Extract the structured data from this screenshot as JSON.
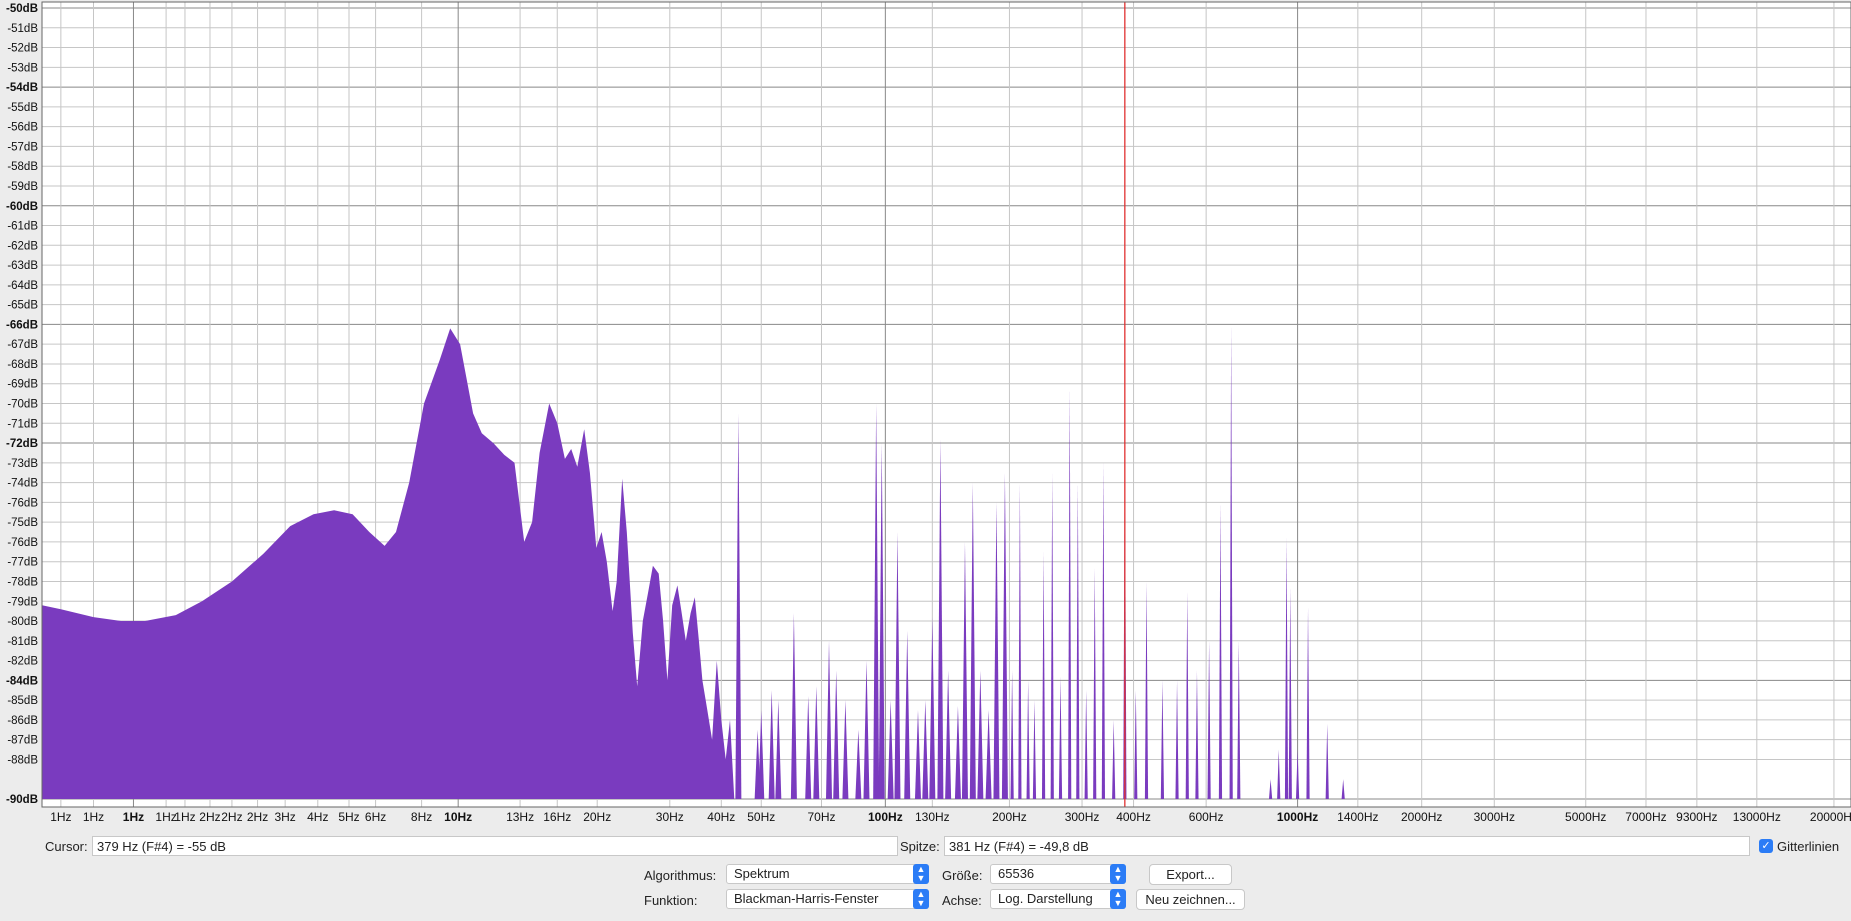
{
  "colors": {
    "plot_background": "#ffffff",
    "grid_major": "#888888",
    "grid_minor": "#c6c6c6",
    "spectrum_fill": "#7a3bbf",
    "cursor_line": "#e03030",
    "accent": "#2b7cf6",
    "panel_background": "#ececec"
  },
  "chart_data": {
    "type": "area",
    "xlabel": "",
    "ylabel": "",
    "x_scale": "log",
    "xlim_hz": [
      0.9,
      22000
    ],
    "ylim_db": [
      -90,
      -50
    ],
    "grid": true,
    "y_ticks": [
      {
        "label": "-50dB",
        "value": -50,
        "bold": true
      },
      {
        "label": "-51dB",
        "value": -51
      },
      {
        "label": "-52dB",
        "value": -52
      },
      {
        "label": "-53dB",
        "value": -53
      },
      {
        "label": "-54dB",
        "value": -54,
        "bold": true
      },
      {
        "label": "-55dB",
        "value": -55
      },
      {
        "label": "-56dB",
        "value": -56
      },
      {
        "label": "-57dB",
        "value": -57
      },
      {
        "label": "-58dB",
        "value": -58
      },
      {
        "label": "-59dB",
        "value": -59
      },
      {
        "label": "-60dB",
        "value": -60,
        "bold": true
      },
      {
        "label": "-61dB",
        "value": -61
      },
      {
        "label": "-62dB",
        "value": -62
      },
      {
        "label": "-63dB",
        "value": -63
      },
      {
        "label": "-64dB",
        "value": -64
      },
      {
        "label": "-65dB",
        "value": -65
      },
      {
        "label": "-66dB",
        "value": -66,
        "bold": true
      },
      {
        "label": "-67dB",
        "value": -67
      },
      {
        "label": "-68dB",
        "value": -68
      },
      {
        "label": "-69dB",
        "value": -69
      },
      {
        "label": "-70dB",
        "value": -70
      },
      {
        "label": "-71dB",
        "value": -71
      },
      {
        "label": "-72dB",
        "value": -72,
        "bold": true
      },
      {
        "label": "-73dB",
        "value": -73
      },
      {
        "label": "-74dB",
        "value": -74
      },
      {
        "label": "-76dB",
        "value": -75
      },
      {
        "label": "-75dB",
        "value": -76
      },
      {
        "label": "-76dB",
        "value": -77
      },
      {
        "label": "-77dB",
        "value": -78
      },
      {
        "label": "-78dB",
        "value": -79
      },
      {
        "label": "-79dB",
        "value": -80
      },
      {
        "label": "-80dB",
        "value": -81
      },
      {
        "label": "-81dB",
        "value": -82
      },
      {
        "label": "-82dB",
        "value": -83
      },
      {
        "label": "-84dB",
        "value": -84,
        "bold": true
      },
      {
        "label": "-85dB",
        "value": -85
      },
      {
        "label": "-86dB",
        "value": -86
      },
      {
        "label": "-87dB",
        "value": -87
      },
      {
        "label": "-88dB",
        "value": -88
      },
      {
        "label": "-90dB",
        "value": -90,
        "bold": true
      }
    ],
    "x_ticks": [
      {
        "label": "1Hz",
        "hz": 1.0
      },
      {
        "label": "1Hz",
        "hz": 1.2
      },
      {
        "label": "1Hz",
        "hz": 1.5,
        "bold": true
      },
      {
        "label": "1Hz",
        "hz": 1.8
      },
      {
        "label": "1Hz",
        "hz": 2.0
      },
      {
        "label": "2Hz",
        "hz": 2.3
      },
      {
        "label": "2Hz",
        "hz": 2.6
      },
      {
        "label": "2Hz",
        "hz": 3.0
      },
      {
        "label": "3Hz",
        "hz": 3.5
      },
      {
        "label": "4Hz",
        "hz": 4.2
      },
      {
        "label": "5Hz",
        "hz": 5.0
      },
      {
        "label": "6Hz",
        "hz": 5.8
      },
      {
        "label": "8Hz",
        "hz": 7.5
      },
      {
        "label": "10Hz",
        "hz": 9.2,
        "bold": true
      },
      {
        "label": "13Hz",
        "hz": 13
      },
      {
        "label": "16Hz",
        "hz": 16
      },
      {
        "label": "20Hz",
        "hz": 20
      },
      {
        "label": "30Hz",
        "hz": 30
      },
      {
        "label": "40Hz",
        "hz": 40
      },
      {
        "label": "50Hz",
        "hz": 50
      },
      {
        "label": "70Hz",
        "hz": 70
      },
      {
        "label": "100Hz",
        "hz": 100,
        "bold": true
      },
      {
        "label": "130Hz",
        "hz": 130
      },
      {
        "label": "200Hz",
        "hz": 200
      },
      {
        "label": "300Hz",
        "hz": 300
      },
      {
        "label": "400Hz",
        "hz": 400
      },
      {
        "label": "600Hz",
        "hz": 600
      },
      {
        "label": "1000Hz",
        "hz": 1000,
        "bold": true
      },
      {
        "label": "1400Hz",
        "hz": 1400
      },
      {
        "label": "2000Hz",
        "hz": 2000
      },
      {
        "label": "3000Hz",
        "hz": 3000
      },
      {
        "label": "5000Hz",
        "hz": 5000
      },
      {
        "label": "7000Hz",
        "hz": 7000
      },
      {
        "label": "9300Hz",
        "hz": 9300
      },
      {
        "label": "13000Hz",
        "hz": 13000
      },
      {
        "label": "20000Hz",
        "hz": 20000
      }
    ],
    "series": [
      {
        "continuous_envelope": [
          [
            0.9,
            -80.2
          ],
          [
            1.0,
            -80.4
          ],
          [
            1.2,
            -80.8
          ],
          [
            1.4,
            -81.0
          ],
          [
            1.6,
            -81.0
          ],
          [
            1.9,
            -80.7
          ],
          [
            2.2,
            -80.0
          ],
          [
            2.6,
            -79.0
          ],
          [
            3.1,
            -77.6
          ],
          [
            3.6,
            -76.2
          ],
          [
            4.1,
            -75.6
          ],
          [
            4.6,
            -75.4
          ],
          [
            5.1,
            -75.6
          ],
          [
            5.6,
            -76.5
          ],
          [
            6.1,
            -77.2
          ],
          [
            6.5,
            -76.5
          ],
          [
            7.0,
            -74.0
          ],
          [
            7.6,
            -70.0
          ],
          [
            8.3,
            -67.8
          ],
          [
            8.8,
            -66.2
          ],
          [
            9.3,
            -67.0
          ],
          [
            10.0,
            -70.5
          ],
          [
            10.5,
            -71.5
          ],
          [
            11.2,
            -72.0
          ],
          [
            11.9,
            -72.6
          ],
          [
            12.6,
            -73.0
          ],
          [
            13.3,
            -77.0
          ],
          [
            13.9,
            -76.0
          ],
          [
            14.5,
            -72.5
          ],
          [
            15.3,
            -70.0
          ],
          [
            16.0,
            -71.0
          ],
          [
            16.7,
            -72.8
          ],
          [
            17.3,
            -72.3
          ],
          [
            17.9,
            -73.2
          ],
          [
            18.6,
            -71.3
          ],
          [
            19.2,
            -73.5
          ],
          [
            19.9,
            -77.3
          ],
          [
            20.5,
            -76.5
          ],
          [
            21.1,
            -78.0
          ],
          [
            21.8,
            -80.5
          ],
          [
            22.3,
            -79.0
          ],
          [
            23.0,
            -73.8
          ],
          [
            23.6,
            -76.5
          ],
          [
            24.4,
            -81.6
          ],
          [
            25.0,
            -84.3
          ],
          [
            25.8,
            -81.0
          ],
          [
            26.6,
            -79.5
          ],
          [
            27.3,
            -78.2
          ],
          [
            28.2,
            -78.6
          ],
          [
            28.9,
            -81.0
          ],
          [
            29.6,
            -84.0
          ],
          [
            30.4,
            -80.2
          ],
          [
            31.3,
            -79.2
          ],
          [
            32.0,
            -80.5
          ],
          [
            32.8,
            -82.0
          ],
          [
            33.7,
            -80.6
          ],
          [
            34.5,
            -79.8
          ],
          [
            35.3,
            -82.0
          ],
          [
            36.0,
            -84.0
          ],
          [
            37.0,
            -85.5
          ],
          [
            38.0,
            -87.0
          ],
          [
            39.0,
            -83.0
          ],
          [
            40.0,
            -86.0
          ],
          [
            41.0,
            -88.0
          ],
          [
            42.0,
            -86.0
          ],
          [
            43.0,
            -90.0
          ]
        ],
        "peaks_hz_db": [
          [
            44,
            -70.5
          ],
          [
            49,
            -86.5
          ],
          [
            50,
            -85.5
          ],
          [
            53,
            -84.5
          ],
          [
            55,
            -85.0
          ],
          [
            60,
            -80.6
          ],
          [
            65,
            -84.8
          ],
          [
            68,
            -84.3
          ],
          [
            73,
            -82.0
          ],
          [
            76,
            -83.5
          ],
          [
            80,
            -85.0
          ],
          [
            86,
            -86.5
          ],
          [
            90,
            -83.0
          ],
          [
            95,
            -70.0
          ],
          [
            98,
            -72.0
          ],
          [
            103,
            -85.0
          ],
          [
            107,
            -76.5
          ],
          [
            113,
            -81.5
          ],
          [
            120,
            -85.5
          ],
          [
            125,
            -85.0
          ],
          [
            130,
            -80.8
          ],
          [
            136,
            -71.8
          ],
          [
            142,
            -83.5
          ],
          [
            150,
            -85.3
          ],
          [
            156,
            -77.0
          ],
          [
            163,
            -74.0
          ],
          [
            170,
            -83.5
          ],
          [
            178,
            -85.5
          ],
          [
            186,
            -75.0
          ],
          [
            195,
            -73.5
          ],
          [
            203,
            -83.5
          ],
          [
            212,
            -74.0
          ],
          [
            222,
            -84.0
          ],
          [
            230,
            -85.0
          ],
          [
            242,
            -77.5
          ],
          [
            254,
            -73.5
          ],
          [
            266,
            -83.8
          ],
          [
            280,
            -69.2
          ],
          [
            293,
            -74.0
          ],
          [
            307,
            -84.5
          ],
          [
            322,
            -78.3
          ],
          [
            338,
            -73.0
          ],
          [
            358,
            -86.0
          ],
          [
            381,
            -71.5
          ],
          [
            405,
            -84.5
          ],
          [
            430,
            -79.0
          ],
          [
            470,
            -84.0
          ],
          [
            510,
            -84.0
          ],
          [
            540,
            -79.5
          ],
          [
            570,
            -83.5
          ],
          [
            610,
            -82.0
          ],
          [
            650,
            -75.0
          ],
          [
            690,
            -66.0
          ],
          [
            720,
            -82.0
          ],
          [
            860,
            -89.0
          ],
          [
            900,
            -87.5
          ],
          [
            940,
            -76.8
          ],
          [
            960,
            -79.3
          ],
          [
            1000,
            -87.5
          ],
          [
            1060,
            -80.3
          ],
          [
            1180,
            -86.2
          ],
          [
            1290,
            -89.0
          ]
        ]
      }
    ],
    "cursor_hz": 381
  },
  "cursor_row": {
    "cursor_label": "Cursor:",
    "cursor_value": "379 Hz (F#4) = -55 dB",
    "peak_label": "Spitze:",
    "peak_value": "381 Hz (F#4) = -49,8 dB",
    "gridlines_label": "Gitterlinien",
    "gridlines_checked": true
  },
  "controls": {
    "algorithm_label": "Algorithmus:",
    "algorithm_value": "Spektrum",
    "size_label": "Größe:",
    "size_value": "65536",
    "export_label": "Export...",
    "function_label": "Funktion:",
    "function_value": "Blackman-Harris-Fenster",
    "axis_label": "Achse:",
    "axis_value": "Log. Darstellung",
    "redraw_label": "Neu zeichnen..."
  }
}
